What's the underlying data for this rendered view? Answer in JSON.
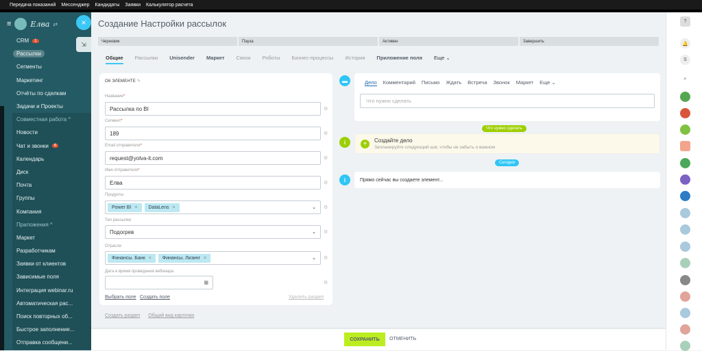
{
  "topbar": {
    "tabs": [
      "Передача показаний",
      "Мессенджер",
      "Кандидаты",
      "Заявки",
      "Калькулятор расчета"
    ]
  },
  "sidebar": {
    "brand": "Елва",
    "items": [
      {
        "label": "CRM",
        "badge": "1"
      },
      {
        "label": "Рассылки",
        "active": true
      },
      {
        "label": "Сегменты"
      },
      {
        "label": "Маркетинг"
      },
      {
        "label": "Отчёты по сделкам"
      },
      {
        "label": "Задачи и Проекты"
      },
      {
        "label": "Совместная работа ^",
        "group": true
      },
      {
        "label": "Новости"
      },
      {
        "label": "Чат и звонки",
        "badge": "6"
      },
      {
        "label": "Календарь"
      },
      {
        "label": "Диск"
      },
      {
        "label": "Почта"
      },
      {
        "label": "Группы"
      },
      {
        "label": "Компания"
      },
      {
        "label": "Приложения ^",
        "group": true
      },
      {
        "label": "Маркет"
      },
      {
        "label": "Разработчикам"
      },
      {
        "label": "Заявки от клиентов"
      },
      {
        "label": "Зависимые поля"
      },
      {
        "label": "Интеграция webinar.ru"
      },
      {
        "label": "Автоматическая рас..."
      },
      {
        "label": "Поиск повторных об..."
      },
      {
        "label": "Быстрое заполнение..."
      },
      {
        "label": "Отправка сообщени..."
      }
    ]
  },
  "main": {
    "title": "Создание Настройки рассылок",
    "stages": [
      "Черновик",
      "Пауза",
      "Активен",
      "Завершить"
    ],
    "tabs": [
      "Общие",
      "Рассылки",
      "Unisender",
      "Маркет",
      "Связи",
      "Роботы",
      "Бизнес-процессы",
      "История",
      "Приложение поля",
      "Еще ⌄"
    ]
  },
  "card": {
    "header": "О6 ЭЛЕМЕНТЕ",
    "fields": {
      "name": {
        "label": "Название",
        "value": "Рассылка по BI"
      },
      "segment": {
        "label": "Сегмент",
        "value": "189"
      },
      "email": {
        "label": "Email отправителя",
        "value": "request@yolva-it.com"
      },
      "sender": {
        "label": "Имя отправителя",
        "value": "Елва"
      },
      "products": {
        "label": "Продукты",
        "chips": [
          "Power BI",
          "DataLens"
        ]
      },
      "type": {
        "label": "Тип рассылки",
        "value": "Подогрев"
      },
      "industries": {
        "label": "Отрасли",
        "chips": [
          "Финансы. Банк",
          "Финансы. Лизинг"
        ]
      },
      "date": {
        "label": "Дата и время проведения вебинара",
        "value": ""
      }
    },
    "select_field": "Выбрать поле",
    "create_field": "Создать поле",
    "delete_section": "Удалить раздел"
  },
  "under": {
    "create_section": "Создать раздел",
    "common_view": "Общий вид карточки"
  },
  "activity": {
    "tabs": [
      "Дело",
      "Комментарий",
      "Письмо",
      "Ждать",
      "Встреча",
      "Звонок",
      "Маркет",
      "Еще ⌄"
    ],
    "placeholder": "Что нужно сделать",
    "pill_todo": "Что нужно сделать",
    "todo_title": "Создайте дело",
    "todo_sub": "Запланируйте следующий шаг, чтобы не забыть о важном",
    "pill_today": "Сегодня",
    "now_text": "Прямо сейчас вы создаете элемент..."
  },
  "footer": {
    "save": "СОХРАНИТЬ",
    "cancel": "ОТМЕНИТЬ"
  },
  "colors": {
    "sidebar": "#245a63",
    "accent": "#3bc8f5",
    "save": "#bbed21",
    "badge": "#e2512f",
    "chip": "#bce8f1"
  }
}
